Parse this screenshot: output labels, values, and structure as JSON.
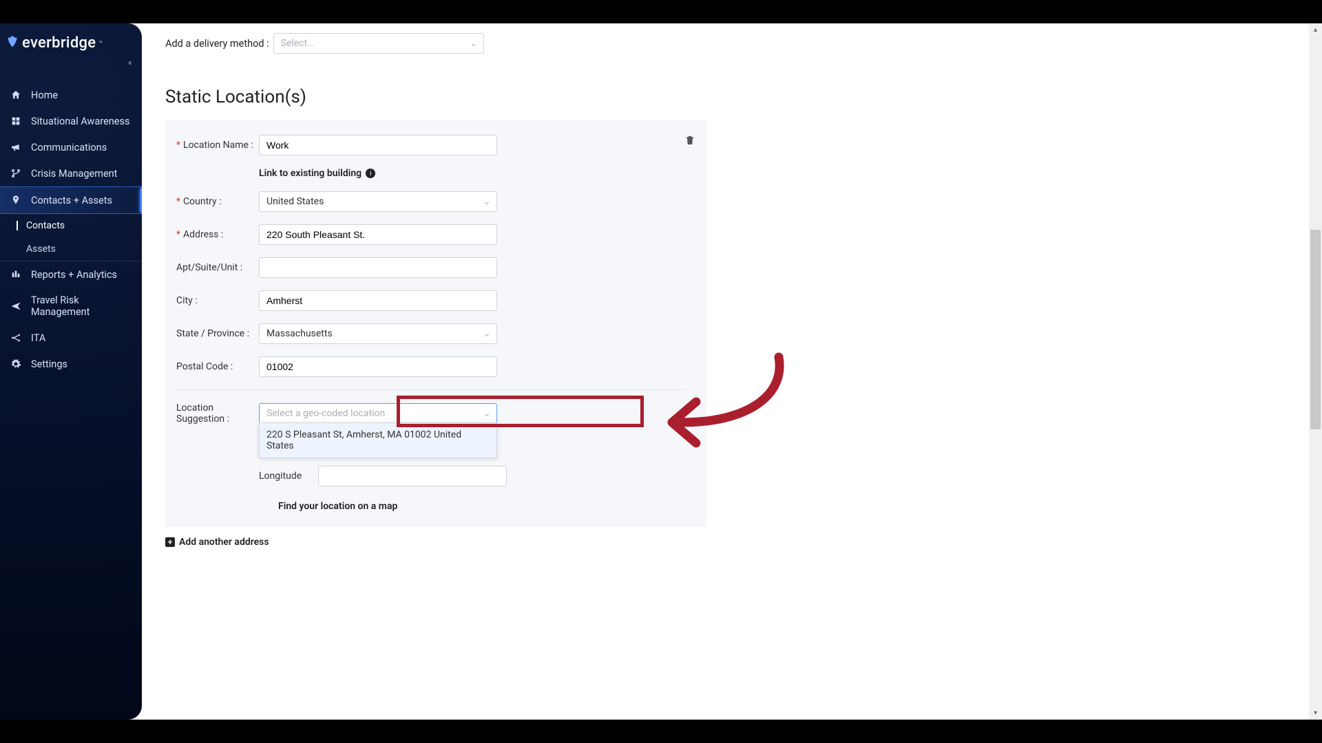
{
  "brand": {
    "name": "everbridge"
  },
  "sidebar": {
    "items": [
      {
        "label": "Home"
      },
      {
        "label": "Situational Awareness"
      },
      {
        "label": "Communications"
      },
      {
        "label": "Crisis Management"
      },
      {
        "label": "Contacts + Assets"
      },
      {
        "label": "Reports + Analytics"
      },
      {
        "label": "Travel Risk Management"
      },
      {
        "label": "ITA"
      },
      {
        "label": "Settings"
      }
    ],
    "sub": [
      {
        "label": "Contacts"
      },
      {
        "label": "Assets"
      }
    ]
  },
  "delivery": {
    "label": "Add a delivery method :",
    "placeholder": "Select..."
  },
  "section_title": "Static Location(s)",
  "form": {
    "location_name": {
      "label": "Location Name :",
      "value": "Work"
    },
    "link_building": "Link to existing building",
    "country": {
      "label": "Country :",
      "value": "United States"
    },
    "address": {
      "label": "Address :",
      "value": "220 South Pleasant St."
    },
    "apt": {
      "label": "Apt/Suite/Unit :"
    },
    "city": {
      "label": "City :",
      "value": "Amherst"
    },
    "state": {
      "label": "State / Province :",
      "value": "Massachusetts"
    },
    "postal": {
      "label": "Postal Code :",
      "value": "01002"
    },
    "suggestion": {
      "label": "Location Suggestion :",
      "placeholder": "Select a geo-coded location",
      "option": "220 S Pleasant St, Amherst, MA 01002 United States"
    },
    "longitude": {
      "label": "Longitude"
    },
    "find_link": "Find your location on a map"
  },
  "add_address": "Add another address"
}
